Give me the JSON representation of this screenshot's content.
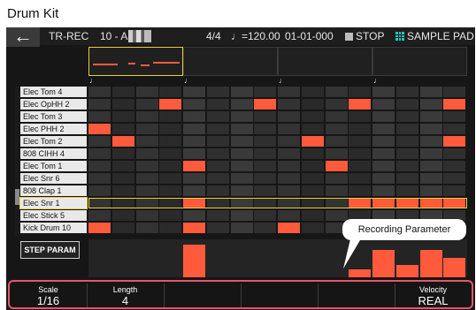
{
  "caption": "Drum Kit",
  "status": {
    "mode": "TR-REC",
    "kit": "10 - A",
    "time_sig": "4/4",
    "tempo": "♩=120.00",
    "position": "01-01-000",
    "transport": "STOP",
    "pad_mode": "SAMPLE PAD"
  },
  "icons": {
    "back": "back-arrow-icon",
    "stop": "stop-square-icon",
    "pads": "pad-grid-icon"
  },
  "colors": {
    "accent": "#ff5a3c",
    "selection": "#e5d13a",
    "callout_border": "#e4576b"
  },
  "beat_marker": "♩",
  "instruments": [
    {
      "name": "Elec Tom 4",
      "steps": []
    },
    {
      "name": "Elec OpHH 2",
      "steps": [
        3,
        7,
        11,
        15
      ]
    },
    {
      "name": "Elec Tom 3",
      "steps": []
    },
    {
      "name": "Elec PHH 2",
      "steps": [
        0
      ]
    },
    {
      "name": "Elec Tom 2",
      "steps": [
        1,
        9,
        15
      ]
    },
    {
      "name": "808 CIHH 4",
      "steps": []
    },
    {
      "name": "Elec Tom 1",
      "steps": [
        4,
        10
      ]
    },
    {
      "name": "Elec Snr 6",
      "steps": []
    },
    {
      "name": "808 Clap 1",
      "steps": []
    },
    {
      "name": "Elec Snr 1",
      "steps": [
        4,
        11,
        12,
        13,
        14,
        15
      ],
      "selected": true
    },
    {
      "name": "Elec Stick 5",
      "steps": []
    },
    {
      "name": "Kick Drum 10",
      "steps": [
        0,
        4,
        8,
        12
      ]
    }
  ],
  "step_param_button": "STEP PARAM",
  "velocity_levels": [
    {
      "step": 4,
      "level": 0.85
    },
    {
      "step": 11,
      "level": 0.2
    },
    {
      "step": 12,
      "level": 0.72
    },
    {
      "step": 13,
      "level": 0.32
    },
    {
      "step": 14,
      "level": 0.72
    },
    {
      "step": 15,
      "level": 0.5
    }
  ],
  "callout": "Recording Parameter",
  "params": [
    {
      "label": "Scale",
      "value": "1/16"
    },
    {
      "label": "Length",
      "value": "4"
    },
    {
      "label": "",
      "value": ""
    },
    {
      "label": "",
      "value": ""
    },
    {
      "label": "",
      "value": ""
    },
    {
      "label": "Velocity",
      "value": "REAL"
    }
  ]
}
